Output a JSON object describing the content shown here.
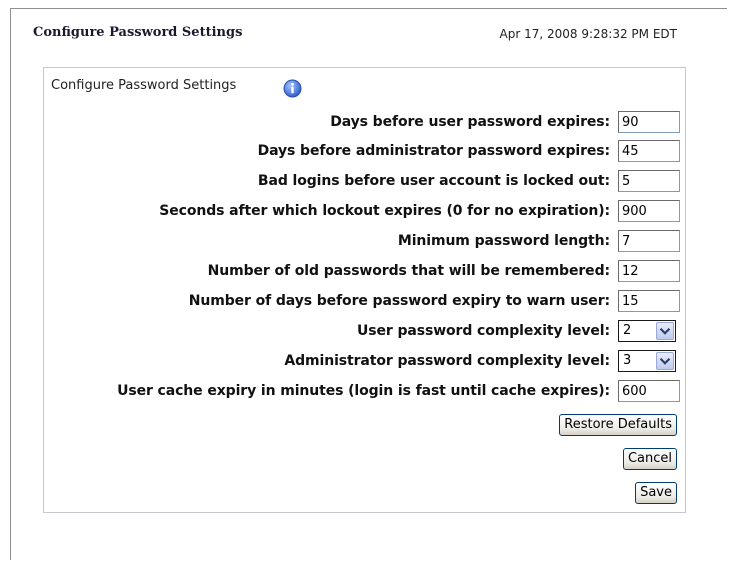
{
  "header": {
    "title": "Configure Password Settings",
    "timestamp": "Apr 17, 2008 9:28:32 PM EDT"
  },
  "panel": {
    "title": "Configure Password Settings",
    "fields": [
      {
        "label": "Days before user password expires:",
        "value": "90"
      },
      {
        "label": "Days before administrator password expires:",
        "value": "45"
      },
      {
        "label": "Bad logins before user account is locked out:",
        "value": "5"
      },
      {
        "label": "Seconds after which lockout expires (0 for no expiration):",
        "value": "900"
      },
      {
        "label": "Minimum password length:",
        "value": "7"
      },
      {
        "label": "Number of old passwords that will be remembered:",
        "value": "12"
      },
      {
        "label": "Number of days before password expiry to warn user:",
        "value": "15"
      },
      {
        "label": "User password complexity level:",
        "value": "2"
      },
      {
        "label": "Administrator password complexity level:",
        "value": "3"
      },
      {
        "label": "User cache expiry in minutes (login is fast until cache expires):",
        "value": "600"
      }
    ],
    "buttons": {
      "restore": "Restore Defaults",
      "cancel": "Cancel",
      "save": "Save"
    }
  },
  "colors": {
    "info_icon": "#3a6fd8",
    "panel_border": "#c6c9cf"
  }
}
